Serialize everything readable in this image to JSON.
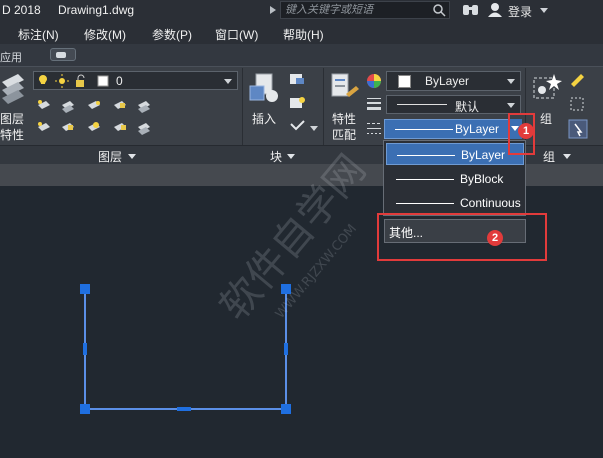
{
  "titlebar": {
    "app_title": "D 2018",
    "doc_title": "Drawing1.dwg",
    "search_placeholder": "键入关键字或短语",
    "login_label": "登录"
  },
  "menu": {
    "items": [
      "标注(N)",
      "修改(M)",
      "参数(P)",
      "窗口(W)",
      "帮助(H)"
    ]
  },
  "ribbon_tabs": {
    "apply_label": "应用"
  },
  "layers_panel": {
    "layer_value": "0",
    "layer_properties_line1": "图层",
    "layer_properties_line2": "特性",
    "footer_label": "图层"
  },
  "block_panel": {
    "insert_label": "插入",
    "footer_label": "块"
  },
  "properties_panel": {
    "match_line1": "特性",
    "match_line2": "匹配",
    "color_value": "ByLayer",
    "lineweight_value": "默认",
    "linetype_value": "ByLayer",
    "linetype_options": [
      "ByLayer",
      "ByBlock",
      "Continuous"
    ],
    "other_label": "其他..."
  },
  "groups_panel": {
    "group_label": "组",
    "footer_label": "组"
  },
  "annotations": {
    "step1": "1",
    "step2": "2"
  },
  "watermark": {
    "text_cn": "软件自学网",
    "text_en": "WWW.RJZXW.COM"
  },
  "colors": {
    "selection_blue": "#3b6fb3",
    "annotation_red": "#e23b3b",
    "canvas_bg": "#212830",
    "grip_blue": "#1f6fe0",
    "line_blue": "#5b8fe6"
  },
  "icons": [
    "search-icon",
    "binoculars-icon",
    "user-icon",
    "layer-stack-icon",
    "bulb-icon",
    "sun-icon",
    "lock-icon",
    "insert-block-icon",
    "match-properties-icon",
    "color-wheel-icon",
    "group-icon",
    "select-icon"
  ]
}
